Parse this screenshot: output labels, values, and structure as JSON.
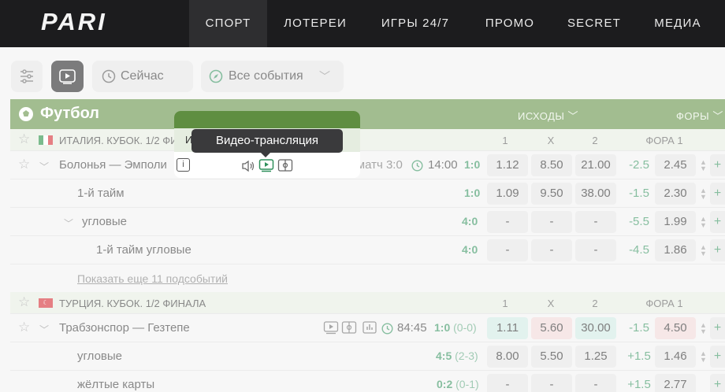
{
  "brand": {
    "logo": "PARI"
  },
  "nav": [
    "СПОРТ",
    "ЛОТЕРЕИ",
    "ИГРЫ 24/7",
    "ПРОМО",
    "SECRET",
    "МЕДИА"
  ],
  "filters": {
    "now_label": "Сейчас",
    "events_label": "Все события"
  },
  "sport": {
    "title": "Футбол",
    "col_outcomes": "ИСХОДЫ",
    "col_handicap": "ФОРЫ"
  },
  "leagues": [
    {
      "name": "ИТАЛИЯ. КУБОК. 1/2 ФИНАЛА",
      "cols": [
        "1",
        "X",
        "2",
        "ФОРА 1"
      ],
      "event": {
        "teams": "Болонья — Эмполи",
        "status": "Первый матч 3:0",
        "time": "14:00",
        "score": "1:0",
        "odds": [
          "1.12",
          "8.50",
          "21.00"
        ],
        "hcap": "-2.5",
        "hodd": "2.45"
      },
      "subs": [
        {
          "name": "1-й тайм",
          "score": "1:0",
          "odds": [
            "1.09",
            "9.50",
            "38.00"
          ],
          "hcap": "-1.5",
          "hodd": "2.30"
        },
        {
          "name": "угловые",
          "score": "4:0",
          "odds": [
            "-",
            "-",
            "-"
          ],
          "hcap": "-5.5",
          "hodd": "1.99"
        },
        {
          "name": "1-й тайм угловые",
          "score": "4:0",
          "odds": [
            "-",
            "-",
            "-"
          ],
          "hcap": "-4.5",
          "hodd": "1.86"
        }
      ],
      "more": "Показать еще 11 подсобытий"
    },
    {
      "name": "ТУРЦИЯ. КУБОК. 1/2 ФИНАЛА",
      "cols": [
        "1",
        "X",
        "2",
        "ФОРА 1"
      ],
      "event": {
        "teams": "Трабзонспор — Гезтепе",
        "time": "84:45",
        "score": "1:0",
        "score_sub": "(0-0)",
        "odds": [
          "1.11",
          "5.60",
          "30.00"
        ],
        "hcap": "-1.5",
        "hodd": "4.50"
      },
      "subs": [
        {
          "name": "угловые",
          "score": "4:5",
          "score_sub": "(2-3)",
          "odds": [
            "8.00",
            "5.50",
            "1.25"
          ],
          "hcap": "+1.5",
          "hodd": "1.46"
        },
        {
          "name": "жёлтые карты",
          "score": "0:2",
          "score_sub": "(0-1)",
          "odds": [
            "-",
            "-",
            "-"
          ],
          "hcap": "+1.5",
          "hodd": "2.77"
        }
      ]
    }
  ],
  "tooltip": "Видео-трансляция",
  "colors": {
    "accent_green": "#5f8e41",
    "score_green": "#2f8f5b",
    "topbar": "#1c1c1e"
  }
}
